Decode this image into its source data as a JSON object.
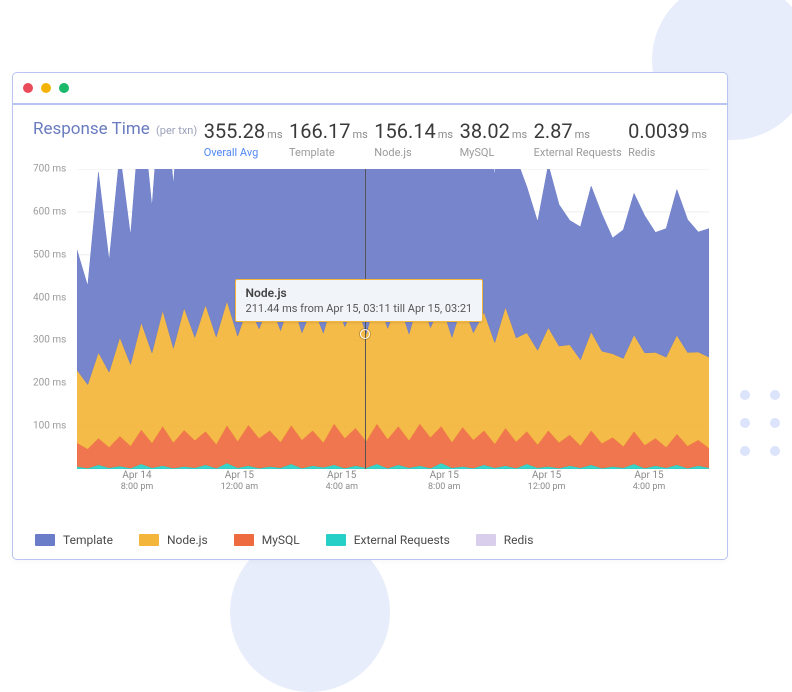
{
  "header": {
    "title": "Response Time",
    "title_suffix": "(per txn)"
  },
  "stats": [
    {
      "value": "355.28",
      "unit": "ms",
      "label": "Overall Avg",
      "key": "overall"
    },
    {
      "value": "166.17",
      "unit": "ms",
      "label": "Template",
      "key": "template"
    },
    {
      "value": "156.14",
      "unit": "ms",
      "label": "Node.js",
      "key": "nodejs"
    },
    {
      "value": "38.02",
      "unit": "ms",
      "label": "MySQL",
      "key": "mysql"
    },
    {
      "value": "2.87",
      "unit": "ms",
      "label": "External Requests",
      "key": "ext"
    },
    {
      "value": "0.0039",
      "unit": "ms",
      "label": "Redis",
      "key": "redis"
    }
  ],
  "tooltip": {
    "title": "Node.js",
    "value": "211.44 ms",
    "range_from": "Apr 15, 03:11",
    "range_till": "Apr 15, 03:21",
    "text": "211.44 ms from Apr 15, 03:11 till Apr 15, 03:21"
  },
  "legend": [
    {
      "label": "Template",
      "color": "#6b7cc8"
    },
    {
      "label": "Node.js",
      "color": "#f3b53a"
    },
    {
      "label": "MySQL",
      "color": "#ee6a3f"
    },
    {
      "label": "External Requests",
      "color": "#27d0c6"
    },
    {
      "label": "Redis",
      "color": "#d9cfec"
    }
  ],
  "chart_data": {
    "type": "area",
    "title": "Response Time (per txn)",
    "xlabel": "",
    "ylabel": "ms",
    "ylim": [
      0,
      700
    ],
    "y_ticks": [
      100,
      200,
      300,
      400,
      500,
      600,
      700
    ],
    "y_tick_suffix": "ms",
    "x_ticks": [
      {
        "line1": "Apr 14",
        "line2": "8:00 pm"
      },
      {
        "line1": "Apr 15",
        "line2": "12:00 am"
      },
      {
        "line1": "Apr 15",
        "line2": "4:00 am"
      },
      {
        "line1": "Apr 15",
        "line2": "8:00 am"
      },
      {
        "line1": "Apr 15",
        "line2": "12:00 pm"
      },
      {
        "line1": "Apr 15",
        "line2": "4:00 pm"
      }
    ],
    "cursor": {
      "x_frac": 0.455,
      "y_value_ms": 255
    },
    "series": [
      {
        "name": "Redis",
        "color": "#d9cfec",
        "values": [
          0,
          0,
          0,
          0,
          0,
          0,
          0,
          0,
          0,
          0,
          0,
          0,
          0,
          0,
          0,
          0,
          0,
          0,
          0,
          0,
          0,
          0,
          0,
          0,
          0,
          0,
          0,
          0,
          0,
          0,
          0,
          0,
          0,
          0,
          0,
          0,
          0,
          0,
          0,
          0,
          0,
          0,
          0,
          0,
          0,
          0,
          0,
          0,
          0,
          0,
          0,
          0,
          0,
          0,
          0,
          0,
          0,
          0,
          0,
          0
        ]
      },
      {
        "name": "External Requests",
        "color": "#27d0c6",
        "values": [
          6,
          2,
          10,
          3,
          7,
          2,
          12,
          3,
          8,
          2,
          6,
          3,
          10,
          2,
          14,
          3,
          8,
          2,
          6,
          3,
          12,
          2,
          8,
          4,
          10,
          2,
          8,
          3,
          12,
          2,
          10,
          3,
          8,
          2,
          14,
          3,
          6,
          2,
          10,
          3,
          8,
          2,
          12,
          3,
          6,
          2,
          8,
          3,
          10,
          2,
          6,
          3,
          12,
          2,
          8,
          3,
          10,
          2,
          8,
          3
        ]
      },
      {
        "name": "MySQL",
        "color": "#ee6a3f",
        "values": [
          55,
          45,
          62,
          48,
          70,
          52,
          80,
          58,
          92,
          60,
          85,
          64,
          78,
          56,
          88,
          62,
          95,
          70,
          84,
          60,
          90,
          66,
          82,
          58,
          96,
          70,
          88,
          62,
          94,
          68,
          90,
          64,
          98,
          72,
          86,
          60,
          92,
          66,
          80,
          56,
          88,
          62,
          76,
          54,
          84,
          60,
          72,
          52,
          80,
          58,
          68,
          50,
          76,
          54,
          64,
          48,
          72,
          52,
          60,
          46
        ]
      },
      {
        "name": "Node.js",
        "color": "#f3b53a",
        "values": [
          170,
          150,
          200,
          175,
          230,
          190,
          250,
          210,
          270,
          220,
          285,
          240,
          295,
          250,
          290,
          245,
          280,
          255,
          300,
          260,
          295,
          250,
          290,
          255,
          300,
          260,
          295,
          250,
          300,
          258,
          292,
          248,
          298,
          256,
          286,
          244,
          290,
          250,
          276,
          236,
          282,
          242,
          230,
          220,
          240,
          225,
          210,
          200,
          230,
          215,
          195,
          205,
          225,
          215,
          200,
          210,
          230,
          218,
          205,
          212
        ]
      },
      {
        "name": "Template",
        "color": "#6b7cc8",
        "values": [
          280,
          230,
          420,
          260,
          430,
          300,
          520,
          340,
          580,
          380,
          640,
          420,
          670,
          430,
          640,
          440,
          610,
          460,
          660,
          450,
          640,
          430,
          600,
          440,
          680,
          470,
          620,
          430,
          640,
          450,
          590,
          420,
          630,
          460,
          560,
          410,
          590,
          430,
          530,
          390,
          560,
          420,
          340,
          300,
          380,
          330,
          290,
          310,
          340,
          320,
          270,
          300,
          330,
          320,
          280,
          300,
          340,
          310,
          280,
          300
        ]
      }
    ]
  }
}
